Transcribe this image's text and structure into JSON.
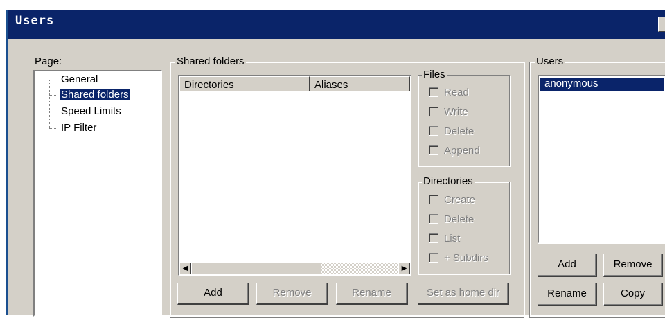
{
  "window": {
    "title": "Users"
  },
  "page_panel": {
    "label": "Page:",
    "items": [
      {
        "label": "General"
      },
      {
        "label": "Shared folders",
        "selected": true
      },
      {
        "label": "Speed Limits"
      },
      {
        "label": "IP Filter"
      }
    ]
  },
  "shared_folders": {
    "caption": "Shared folders",
    "columns": [
      "Directories",
      "Aliases"
    ],
    "rows": [],
    "buttons": {
      "add": "Add",
      "remove": "Remove",
      "rename": "Rename",
      "set_home": "Set as home dir"
    }
  },
  "files_group": {
    "caption": "Files",
    "options": [
      {
        "label": "Read",
        "checked": false
      },
      {
        "label": "Write",
        "checked": false
      },
      {
        "label": "Delete",
        "checked": false
      },
      {
        "label": "Append",
        "checked": false
      }
    ]
  },
  "directories_group": {
    "caption": "Directories",
    "options": [
      {
        "label": "Create",
        "checked": false
      },
      {
        "label": "Delete",
        "checked": false
      },
      {
        "label": "List",
        "checked": false
      },
      {
        "label": "+ Subdirs",
        "checked": false
      }
    ]
  },
  "users_panel": {
    "caption": "Users",
    "users": [
      {
        "name": "anonymous",
        "selected": true
      }
    ],
    "buttons": {
      "add": "Add",
      "remove": "Remove",
      "rename": "Rename",
      "copy": "Copy"
    }
  },
  "colors": {
    "titlebar": "#0a2469",
    "selection": "#0a246a",
    "face": "#d4d0c8"
  }
}
